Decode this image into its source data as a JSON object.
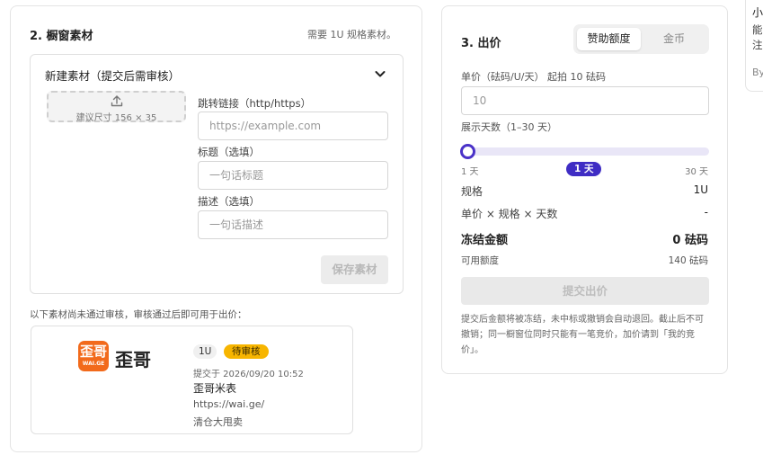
{
  "panel2": {
    "title": "2. 橱窗素材",
    "hint": "需要 1U 规格素材。",
    "new_material": {
      "title": "新建素材（提交后需审核）",
      "upload_text": "建议尺寸 156 × 35",
      "link_label": "跳转链接（http/https）",
      "link_placeholder": "https://example.com",
      "title_label": "标题（选填）",
      "title_placeholder": "一句话标题",
      "desc_label": "描述（选填）",
      "desc_placeholder": "一句话描述",
      "save_label": "保存素材"
    },
    "pending_note": "以下素材尚未通过审核，审核通过后即可用于出价：",
    "pending_item": {
      "logo_mark_main": "歪哥",
      "logo_mark_sub": "WAI.GE",
      "logo_text": "歪哥",
      "size_badge": "1U",
      "status_badge": "待审核",
      "submit_time": "提交于 2026/09/20 10:52",
      "title": "歪哥米表",
      "url": "https://wai.ge/",
      "desc": "清仓大甩卖"
    }
  },
  "panel3": {
    "title": "3. 出价",
    "toggle": {
      "sponsor": "赞助额度",
      "coin": "金币",
      "active": "sponsor"
    },
    "price_label": "单价（砝码/U/天）  起拍 10 砝码",
    "price_placeholder": "10",
    "days_label": "展示天数（1–30 天）",
    "slider": {
      "min_label": "1 天",
      "max_label": "30 天",
      "value_label": "1 天",
      "value": 1,
      "min": 1,
      "max": 30
    },
    "spec_label": "规格",
    "spec_value": "1U",
    "formula_label": "单价 × 规格 × 天数",
    "formula_value": "-",
    "frozen_label": "冻结金额",
    "frozen_value": "0 砝码",
    "available_label": "可用额度",
    "available_value": "140 砝码",
    "submit_label": "提交出价",
    "footnote": "提交后金额将被冻结，未中标或撤销会自动退回。截止后不可撤销；同一橱窗位同时只能有一笔竞价，加价请到「我的竞价」。",
    "accent_color": "#3f2dc4"
  },
  "panel4": {
    "line1": "小",
    "line2": "能",
    "line3": "注",
    "line4": "By"
  }
}
